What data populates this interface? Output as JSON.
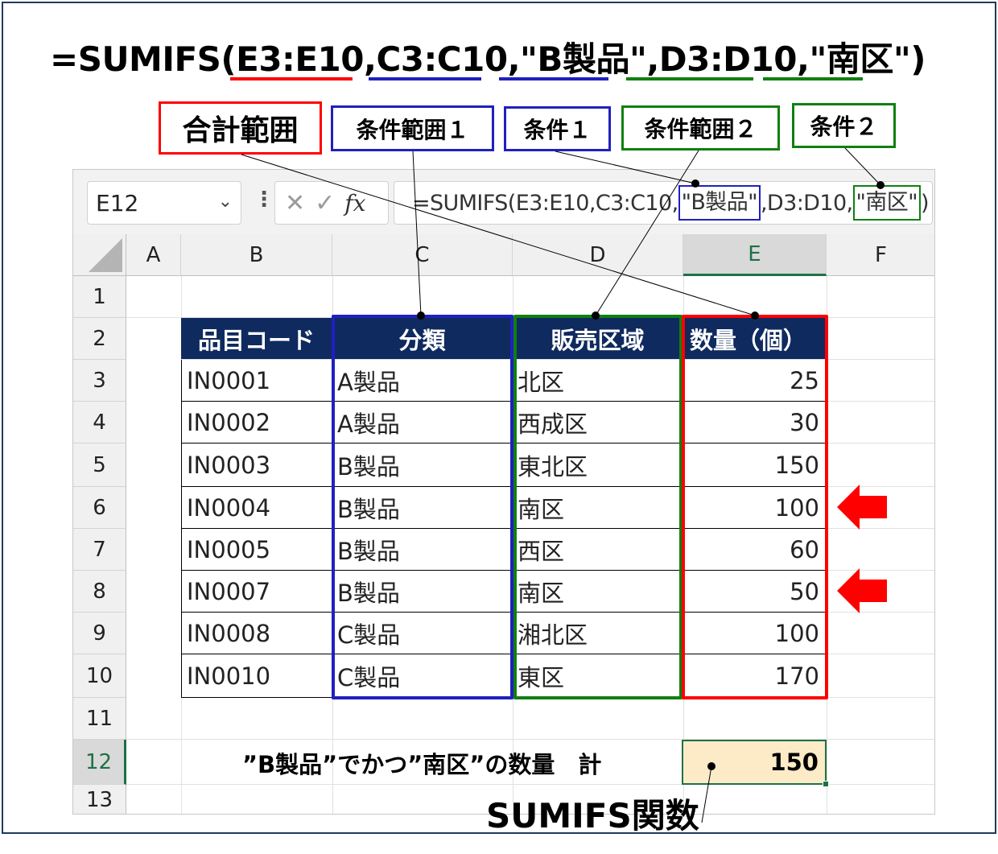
{
  "formula": {
    "eq": "=",
    "fn": "SUMIFS(",
    "arg_sum_range": "E3:E10",
    "comma1": ",",
    "arg_criteria_range1": "C3:C10",
    "comma2": ",",
    "arg_criteria1": "\"B製品\"",
    "comma3": ",",
    "arg_criteria_range2": "D3:D10",
    "comma4": ",",
    "arg_criteria2": "\"南区\"",
    "close": ")"
  },
  "callouts": {
    "sum_range": "合計範囲",
    "criteria_range1": "条件範囲１",
    "criteria1": "条件１",
    "criteria_range2": "条件範囲２",
    "criteria2": "条件２"
  },
  "formula_bar": {
    "name_box": "E12",
    "formula_part1": "=SUMIFS(E3:E10,C3:C10,",
    "formula_crit1": "\"B製品\"",
    "formula_part2": ",D3:D10,",
    "formula_crit2": "\"南区\"",
    "formula_close": ")"
  },
  "columns": [
    "A",
    "B",
    "C",
    "D",
    "E",
    "F"
  ],
  "rows": [
    "1",
    "2",
    "3",
    "4",
    "5",
    "6",
    "7",
    "8",
    "9",
    "10",
    "11",
    "12",
    "13"
  ],
  "table": {
    "headers": [
      "品目コード",
      "分類",
      "販売区域",
      "数量（個）"
    ],
    "rows": [
      [
        "IN0001",
        "A製品",
        "北区",
        "25"
      ],
      [
        "IN0002",
        "A製品",
        "西成区",
        "30"
      ],
      [
        "IN0003",
        "B製品",
        "東北区",
        "150"
      ],
      [
        "IN0004",
        "B製品",
        "南区",
        "100"
      ],
      [
        "IN0005",
        "B製品",
        "西区",
        "60"
      ],
      [
        "IN0007",
        "B製品",
        "南区",
        "50"
      ],
      [
        "IN0008",
        "C製品",
        "湘北区",
        "100"
      ],
      [
        "IN0010",
        "C製品",
        "東区",
        "170"
      ]
    ]
  },
  "summary": {
    "label": "”B製品”でかつ”南区”の数量　計",
    "value": "150"
  },
  "function_label": "SUMIFS関数",
  "colors": {
    "red": "#ff0000",
    "blue": "#2020c0",
    "green": "#108010",
    "header_navy": "#0f2a5e",
    "result_fill": "#fcebc6",
    "excel_green": "#1e7145"
  },
  "icons": {
    "name_box_dropdown": "chevron-down-icon",
    "more": "vertical-dots-icon",
    "cancel": "x-icon",
    "enter": "check-icon",
    "function": "fx-icon",
    "select_all": "select-all-triangle-icon",
    "pointer": "red-left-arrow-icon"
  }
}
